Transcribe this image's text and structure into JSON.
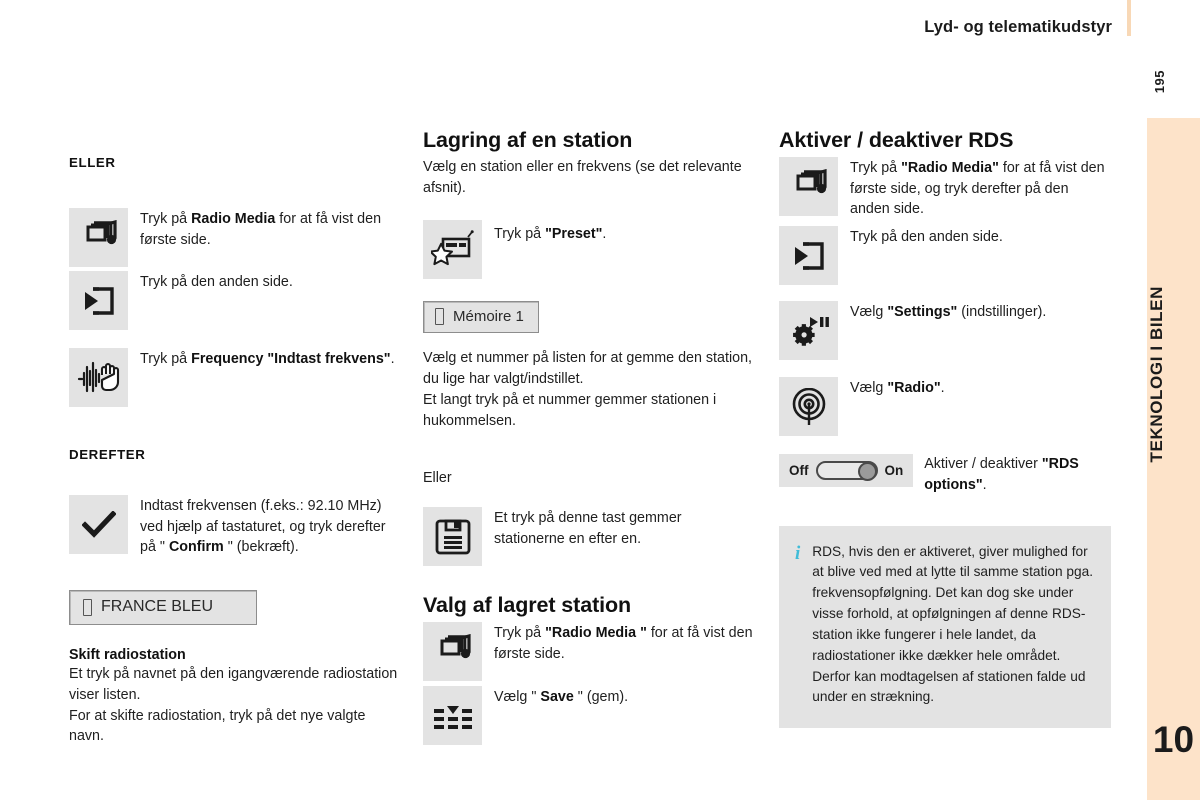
{
  "header": {
    "title": "Lyd- og telematikudstyr",
    "folio": "195"
  },
  "side_tab": {
    "label": "TEKNOLOGI I BILEN",
    "number": "10",
    "color": "#fde3c9"
  },
  "column_left": {
    "kicker_eller": "ELLER",
    "rows": [
      {
        "icon": "radio-media-icon",
        "text_prefix": "Tryk på ",
        "text_bold": "Radio Media",
        "text_suffix": " for at få vist den første side."
      },
      {
        "icon": "other-side-icon",
        "text_prefix": "Tryk på den anden side.",
        "text_bold": "",
        "text_suffix": ""
      },
      {
        "icon": "frequency-hand-icon",
        "text_prefix": "Tryk på ",
        "text_bold": "Frequency \"Indtast frekvens\"",
        "text_suffix": "."
      }
    ],
    "kicker_derefter": "DEREFTER",
    "confirm_row": {
      "icon": "checkmark-icon",
      "text_prefix": "Indtast frekvensen (f.eks.: 92.10 MHz) ved hjælp af tastaturet, og tryk derefter på \" ",
      "text_bold": "Confirm",
      "text_suffix": " \" (bekræft)."
    },
    "chip_station": "FRANCE BLEU",
    "subhead": "Skift radiostation",
    "paragraph": "Et tryk på navnet på den igangværende radiostation viser listen.\nFor at skifte radiostation, tryk på det nye valgte navn."
  },
  "column_middle": {
    "title": "Lagring af en station",
    "lead": "Vælg en station eller en frekvens (se det relevante afsnit).",
    "preset_row": {
      "icon": "preset-radio-star-icon",
      "text_prefix": "Tryk på ",
      "text_bold": "\"Preset\"",
      "text_suffix": "."
    },
    "chip_memory": "Mémoire 1",
    "paragraph": "Vælg et nummer på listen for at gemme den station, du lige har valgt/indstillet.\nEt langt tryk på et nummer gemmer stationen i hukommelsen.",
    "eller": "Eller",
    "save_row": {
      "icon": "floppy-disk-icon",
      "text_prefix": "Et tryk på denne tast gemmer stationerne en efter en.",
      "text_bold": "",
      "text_suffix": ""
    },
    "title2": "Valg af lagret station",
    "rows2": [
      {
        "icon": "radio-media-icon",
        "text_prefix": "Tryk på ",
        "text_bold": "\"Radio Media \"",
        "text_suffix": " for at få vist den første side."
      },
      {
        "icon": "list-save-icon",
        "text_prefix": "Vælg \" ",
        "text_bold": "Save",
        "text_suffix": " \" (gem)."
      }
    ]
  },
  "column_right": {
    "title": "Aktiver / deaktiver RDS",
    "rows": [
      {
        "icon": "radio-media-icon",
        "text_prefix": "Tryk på ",
        "text_bold": "\"Radio Media\"",
        "text_suffix": " for at få vist den første side, og tryk derefter på den anden side."
      },
      {
        "icon": "other-side-icon",
        "text_prefix": "Tryk på den anden side.",
        "text_bold": "",
        "text_suffix": ""
      },
      {
        "icon": "settings-gear-icon",
        "text_prefix": "Vælg ",
        "text_bold": "\"Settings\"",
        "text_suffix": " (indstillinger)."
      },
      {
        "icon": "radio-antenna-icon",
        "text_prefix": "Vælg ",
        "text_bold": "\"Radio\"",
        "text_suffix": "."
      }
    ],
    "toggle": {
      "off_label": "Off",
      "on_label": "On",
      "state": "on"
    },
    "toggle_row": {
      "text_prefix": "Aktiver / deaktiver ",
      "text_bold": "\"RDS options\"",
      "text_suffix": "."
    },
    "note": {
      "icon": "info-icon",
      "text": "RDS, hvis den er aktiveret, giver mulighed for at blive ved med at lytte til samme station pga. frekvensopfølgning. Det kan dog ske under visse forhold, at opfølgningen af denne RDS-station ikke fungerer i hele landet, da radiostationer ikke dækker hele området. Derfor kan modtagelsen af stationen falde ud under en strækning."
    }
  }
}
